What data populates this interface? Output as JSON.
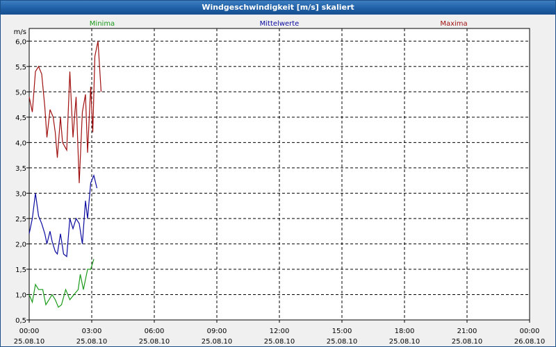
{
  "window": {
    "title": "Windgeschwindigkeit [m/s] skaliert"
  },
  "colors": {
    "min": "#1a9a1a",
    "mean": "#0a0aa0",
    "max": "#a01010",
    "grid": "#000000",
    "plot_bg": "#ffffff"
  },
  "chart_data": {
    "type": "line",
    "title": "Windgeschwindigkeit [m/s] skaliert",
    "ylabel": "m/s",
    "ylim": [
      0.5,
      6.25
    ],
    "xlim_hours": [
      0,
      24
    ],
    "y_ticks": [
      "0,5",
      "1,0",
      "1,5",
      "2,0",
      "2,5",
      "3,0",
      "3,5",
      "4,0",
      "4,5",
      "5,0",
      "5,5",
      "6,0"
    ],
    "x_ticks": [
      {
        "time": "00:00",
        "date": "25.08.10"
      },
      {
        "time": "03:00",
        "date": "25.08.10"
      },
      {
        "time": "06:00",
        "date": "25.08.10"
      },
      {
        "time": "09:00",
        "date": "25.08.10"
      },
      {
        "time": "12:00",
        "date": "25.08.10"
      },
      {
        "time": "15:00",
        "date": "25.08.10"
      },
      {
        "time": "18:00",
        "date": "25.08.10"
      },
      {
        "time": "21:00",
        "date": "25.08.10"
      },
      {
        "time": "00:00",
        "date": "26.08.10"
      }
    ],
    "grid": true,
    "series": [
      {
        "name": "Minima",
        "color": "#1a9a1a",
        "points": [
          [
            0,
            1.0
          ],
          [
            0.15,
            0.85
          ],
          [
            0.3,
            1.2
          ],
          [
            0.45,
            1.1
          ],
          [
            0.65,
            1.1
          ],
          [
            0.8,
            0.8
          ],
          [
            0.95,
            0.9
          ],
          [
            1.1,
            1.0
          ],
          [
            1.25,
            0.9
          ],
          [
            1.4,
            0.75
          ],
          [
            1.55,
            0.8
          ],
          [
            1.75,
            1.1
          ],
          [
            1.95,
            0.9
          ],
          [
            2.15,
            1.0
          ],
          [
            2.35,
            1.1
          ],
          [
            2.45,
            1.4
          ],
          [
            2.6,
            1.1
          ],
          [
            2.8,
            1.5
          ],
          [
            2.95,
            1.5
          ],
          [
            3.1,
            1.7
          ]
        ]
      },
      {
        "name": "Mittelwerte",
        "color": "#0a0aa0",
        "points": [
          [
            0,
            2.2
          ],
          [
            0.15,
            2.5
          ],
          [
            0.3,
            3.0
          ],
          [
            0.45,
            2.55
          ],
          [
            0.6,
            2.4
          ],
          [
            0.75,
            2.2
          ],
          [
            0.85,
            2.0
          ],
          [
            1.0,
            2.25
          ],
          [
            1.1,
            2.05
          ],
          [
            1.25,
            1.85
          ],
          [
            1.35,
            1.8
          ],
          [
            1.5,
            2.2
          ],
          [
            1.65,
            1.8
          ],
          [
            1.8,
            1.75
          ],
          [
            1.95,
            2.5
          ],
          [
            2.1,
            2.3
          ],
          [
            2.25,
            2.5
          ],
          [
            2.4,
            2.4
          ],
          [
            2.55,
            2.0
          ],
          [
            2.7,
            2.85
          ],
          [
            2.8,
            2.5
          ],
          [
            2.95,
            3.2
          ],
          [
            3.1,
            3.35
          ],
          [
            3.25,
            3.1
          ]
        ]
      },
      {
        "name": "Maxima",
        "color": "#a01010",
        "points": [
          [
            0,
            4.9
          ],
          [
            0.15,
            4.6
          ],
          [
            0.3,
            5.4
          ],
          [
            0.45,
            5.5
          ],
          [
            0.6,
            5.35
          ],
          [
            0.75,
            4.7
          ],
          [
            0.85,
            4.1
          ],
          [
            1.0,
            4.65
          ],
          [
            1.15,
            4.5
          ],
          [
            1.25,
            4.2
          ],
          [
            1.35,
            3.7
          ],
          [
            1.5,
            4.5
          ],
          [
            1.6,
            4.0
          ],
          [
            1.8,
            3.85
          ],
          [
            1.95,
            5.4
          ],
          [
            2.1,
            4.1
          ],
          [
            2.25,
            4.9
          ],
          [
            2.4,
            3.2
          ],
          [
            2.55,
            4.6
          ],
          [
            2.7,
            4.95
          ],
          [
            2.8,
            3.8
          ],
          [
            2.95,
            5.1
          ],
          [
            3.05,
            4.2
          ],
          [
            3.15,
            5.7
          ],
          [
            3.3,
            6.0
          ],
          [
            3.45,
            5.0
          ]
        ]
      }
    ]
  }
}
